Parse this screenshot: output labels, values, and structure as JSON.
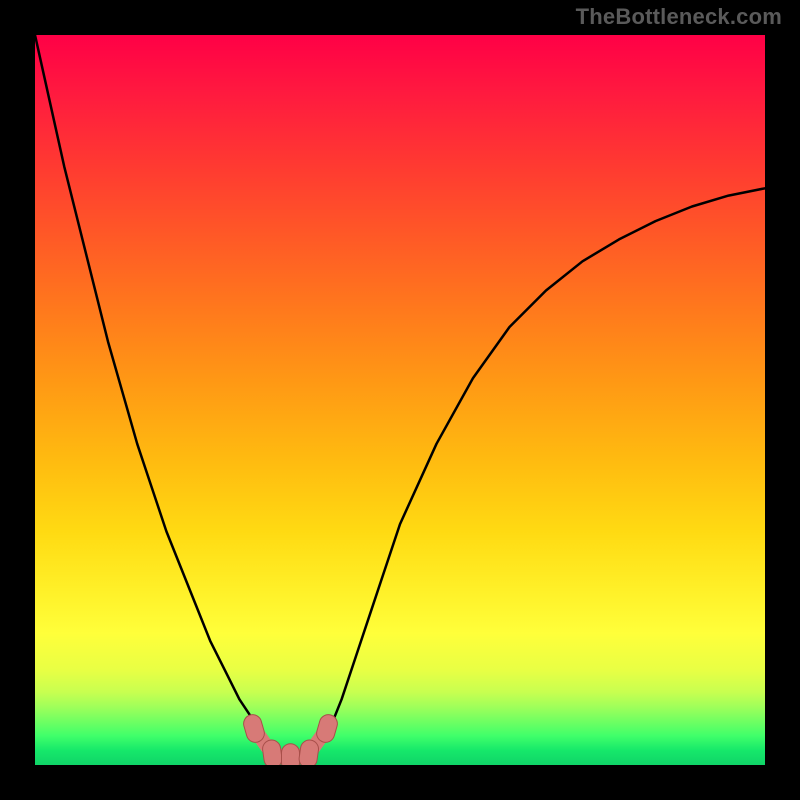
{
  "watermark": "TheBottleneck.com",
  "colors": {
    "background_frame": "#000000",
    "gradient_top": "#ff0046",
    "gradient_mid1": "#ff7a1c",
    "gradient_mid2": "#ffda12",
    "gradient_bottom": "#10d468",
    "curve_stroke": "#000000",
    "marker_fill": "#d77a77",
    "marker_stroke": "#a84f4a"
  },
  "chart_data": {
    "type": "line",
    "title": "",
    "xlabel": "",
    "ylabel": "",
    "xlim": [
      0,
      100
    ],
    "ylim": [
      0,
      100
    ],
    "grid": false,
    "legend": false,
    "x": [
      0,
      2,
      4,
      6,
      8,
      10,
      12,
      14,
      16,
      18,
      20,
      22,
      24,
      26,
      28,
      30,
      32,
      34,
      36,
      38,
      40,
      42,
      44,
      46,
      48,
      50,
      55,
      60,
      65,
      70,
      75,
      80,
      85,
      90,
      95,
      100
    ],
    "values": [
      100,
      91,
      82,
      74,
      66,
      58,
      51,
      44,
      38,
      32,
      27,
      22,
      17,
      13,
      9,
      6,
      3,
      1.5,
      0.8,
      1,
      4,
      9,
      15,
      21,
      27,
      33,
      44,
      53,
      60,
      65,
      69,
      72,
      74.5,
      76.5,
      78,
      79
    ],
    "notes": "Values are percentage heights within the colored plot area. Curve descends steeply from top-left, reaches a minimum near x≈35, then rises with diminishing slope toward the right.",
    "markers": [
      {
        "shape": "rounded",
        "x": 30,
        "y": 5
      },
      {
        "shape": "rounded",
        "x": 32.5,
        "y": 1.5
      },
      {
        "shape": "rounded",
        "x": 35,
        "y": 1
      },
      {
        "shape": "rounded",
        "x": 37.5,
        "y": 1.5
      },
      {
        "shape": "rounded",
        "x": 40,
        "y": 5
      }
    ]
  }
}
